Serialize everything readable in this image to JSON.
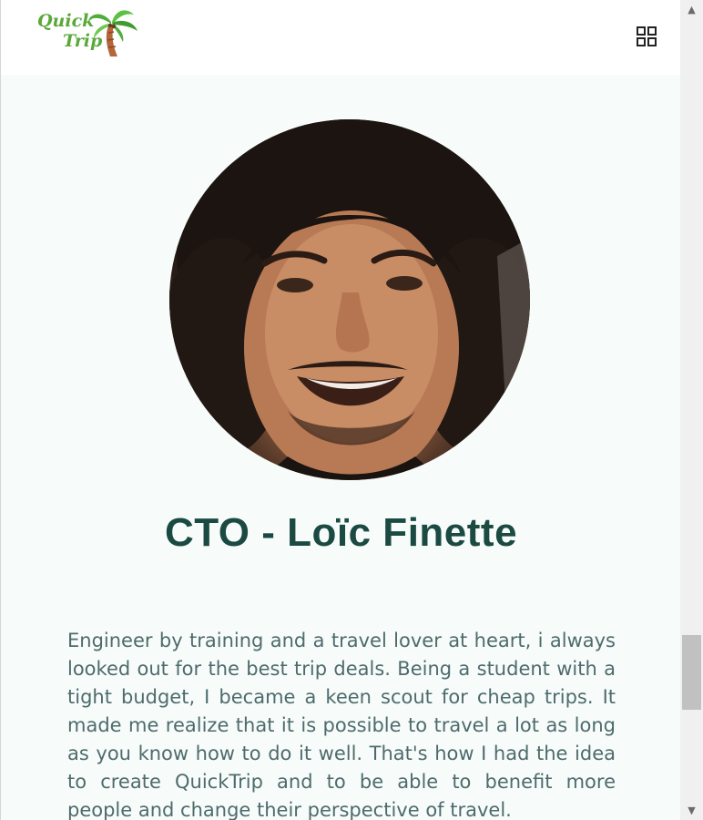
{
  "header": {
    "logo_line1": "Quick",
    "logo_line2": "Trip",
    "menu_icon": "grid-icon"
  },
  "profile": {
    "title": "CTO - Loïc Finette",
    "bio": "Engineer by training and a travel lover at heart, i always looked out for the best trip deals. Being a student with a tight budget, I became a keen scout for cheap trips. It made me realize that it is possible to travel a lot as long as you know how to do it well. That's how I had the idea to create QuickTrip and to be able to benefit more people and change their perspective of travel."
  },
  "scrollbar": {
    "up_icon": "triangle-up-icon",
    "down_icon": "triangle-down-icon",
    "position": 0.88
  },
  "colors": {
    "accent": "#5aa83a",
    "title": "#1b4a42",
    "text": "#4e6b6b",
    "background": "#f7fcfb"
  }
}
